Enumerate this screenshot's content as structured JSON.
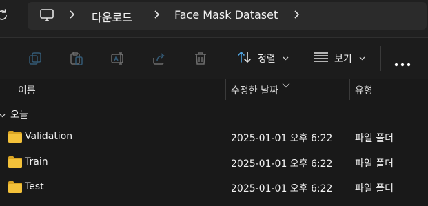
{
  "address_bar": {
    "breadcrumbs": [
      "다운로드",
      "Face Mask Dataset"
    ]
  },
  "command_bar": {
    "sort_label": "정렬",
    "view_label": "보기"
  },
  "columns": {
    "name": "이름",
    "date_modified": "수정한 날짜",
    "type": "유형"
  },
  "group": {
    "label": "오늘"
  },
  "files": [
    {
      "name": "Validation",
      "date_modified": "2025-01-01 오후 6:22",
      "type": "파일 폴더"
    },
    {
      "name": "Train",
      "date_modified": "2025-01-01 오후 6:22",
      "type": "파일 폴더"
    },
    {
      "name": "Test",
      "date_modified": "2025-01-01 오후 6:22",
      "type": "파일 폴더"
    }
  ],
  "colors": {
    "background": "#191919",
    "address_box": "#2b2b2b",
    "folder_yellow": "#f3c13a",
    "accent_blue": "#4fa3e0"
  },
  "icons": {
    "refresh": "refresh-icon",
    "this_pc": "monitor-icon",
    "copy": "copy-icon",
    "paste": "paste-icon",
    "rename": "rename-icon",
    "share": "share-icon",
    "delete": "trash-icon",
    "sort": "sort-icon",
    "view": "view-icon",
    "more": "more-icon",
    "folder": "folder-icon"
  }
}
